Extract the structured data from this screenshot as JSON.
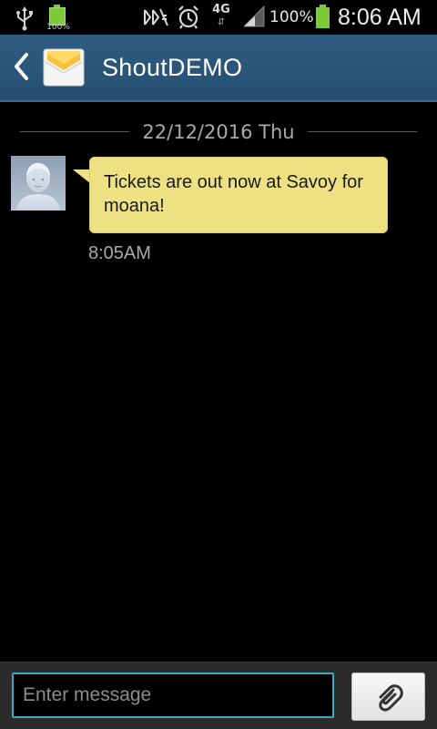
{
  "status_bar": {
    "battery_small_label": "100%",
    "network_type": "4G",
    "network_arrows": "⇵",
    "battery_percent": "100%",
    "time": "8:06 AM",
    "icons": [
      "usb-icon",
      "battery-charging-icon",
      "mute-icon",
      "alarm-icon",
      "signal-icon",
      "battery-icon"
    ]
  },
  "action_bar": {
    "title": "ShoutDEMO",
    "icons": [
      "back-arrow-icon",
      "envelope-icon"
    ]
  },
  "conversation": {
    "date": "22/12/2016 Thu",
    "messages": [
      {
        "text": "Tickets are out now at Savoy for moana!",
        "time": "8:05AM",
        "direction": "incoming"
      }
    ]
  },
  "compose": {
    "placeholder": "Enter message",
    "attach_icon": "paperclip-icon"
  },
  "colors": {
    "action_bar": "#2b5779",
    "bubble": "#ede184",
    "input_border": "#3aa6c8",
    "battery": "#7cc93a"
  }
}
